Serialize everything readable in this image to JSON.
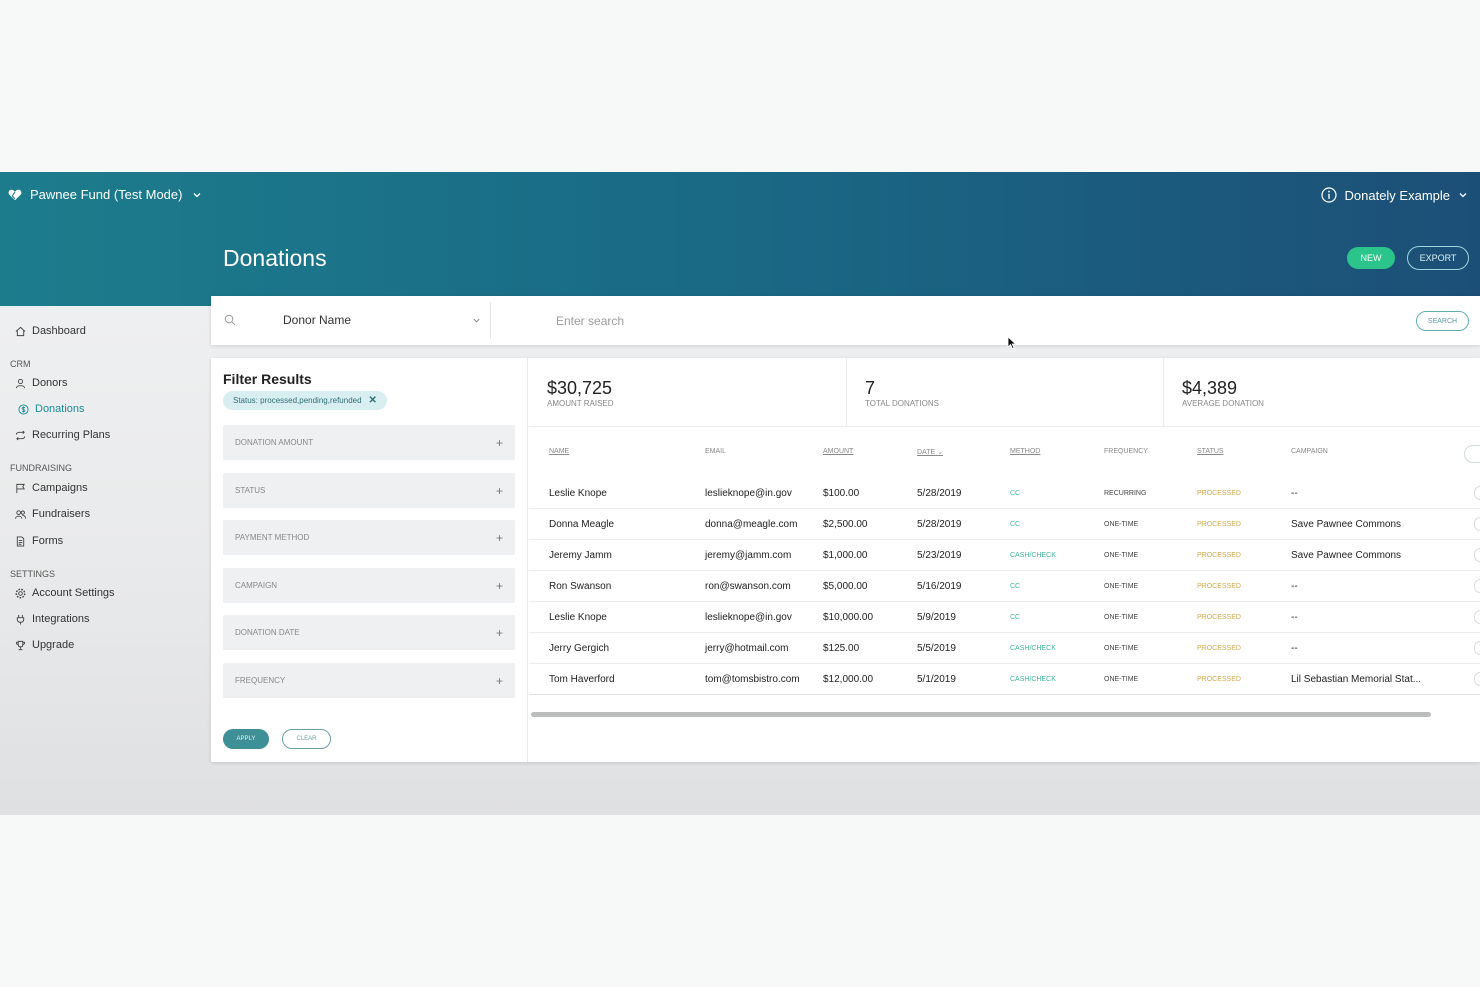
{
  "header": {
    "org": "Pawnee Fund (Test Mode)",
    "account": "Donately Example",
    "title": "Donations",
    "new_label": "NEW",
    "export_label": "EXPORT"
  },
  "sidebar": {
    "dashboard": "Dashboard",
    "crm_label": "CRM",
    "donors": "Donors",
    "donations": "Donations",
    "recurring": "Recurring Plans",
    "fundraising_label": "FUNDRAISING",
    "campaigns": "Campaigns",
    "fundraisers": "Fundraisers",
    "forms": "Forms",
    "settings_label": "SETTINGS",
    "account_settings": "Account Settings",
    "integrations": "Integrations",
    "upgrade": "Upgrade"
  },
  "search": {
    "field": "Donor Name",
    "placeholder": "Enter search",
    "button": "SEARCH"
  },
  "filters": {
    "title": "Filter Results",
    "chip": "Status: processed,pending,refunded",
    "items": [
      "DONATION AMOUNT",
      "STATUS",
      "PAYMENT METHOD",
      "CAMPAIGN",
      "DONATION DATE",
      "FREQUENCY"
    ],
    "apply": "APPLY",
    "clear": "CLEAR"
  },
  "stats": [
    {
      "value": "$30,725",
      "label": "AMOUNT RAISED"
    },
    {
      "value": "7",
      "label": "TOTAL DONATIONS"
    },
    {
      "value": "$4,389",
      "label": "AVERAGE DONATION"
    }
  ],
  "table": {
    "headers": [
      "NAME",
      "EMAIL",
      "AMOUNT",
      "DATE",
      "METHOD",
      "FREQUENCY",
      "STATUS",
      "CAMPAIGN"
    ],
    "date_sort_glyph": "⌄",
    "rows": [
      [
        "Leslie Knope",
        "leslieknope@in.gov",
        "$100.00",
        "5/28/2019",
        "CC",
        "RECURRING",
        "PROCESSED",
        "--"
      ],
      [
        "Donna Meagle",
        "donna@meagle.com",
        "$2,500.00",
        "5/28/2019",
        "CC",
        "ONE-TIME",
        "PROCESSED",
        "Save Pawnee Commons"
      ],
      [
        "Jeremy Jamm",
        "jeremy@jamm.com",
        "$1,000.00",
        "5/23/2019",
        "CASH/CHECK",
        "ONE-TIME",
        "PROCESSED",
        "Save Pawnee Commons"
      ],
      [
        "Ron Swanson",
        "ron@swanson.com",
        "$5,000.00",
        "5/16/2019",
        "CC",
        "ONE-TIME",
        "PROCESSED",
        "--"
      ],
      [
        "Leslie Knope",
        "leslieknope@in.gov",
        "$10,000.00",
        "5/9/2019",
        "CC",
        "ONE-TIME",
        "PROCESSED",
        "--"
      ],
      [
        "Jerry Gergich",
        "jerry@hotmail.com",
        "$125.00",
        "5/5/2019",
        "CASH/CHECK",
        "ONE-TIME",
        "PROCESSED",
        "--"
      ],
      [
        "Tom Haverford",
        "tom@tomsbistro.com",
        "$12,000.00",
        "5/1/2019",
        "CASH/CHECK",
        "ONE-TIME",
        "PROCESSED",
        "Lil Sebastian Memorial Stat..."
      ]
    ]
  }
}
